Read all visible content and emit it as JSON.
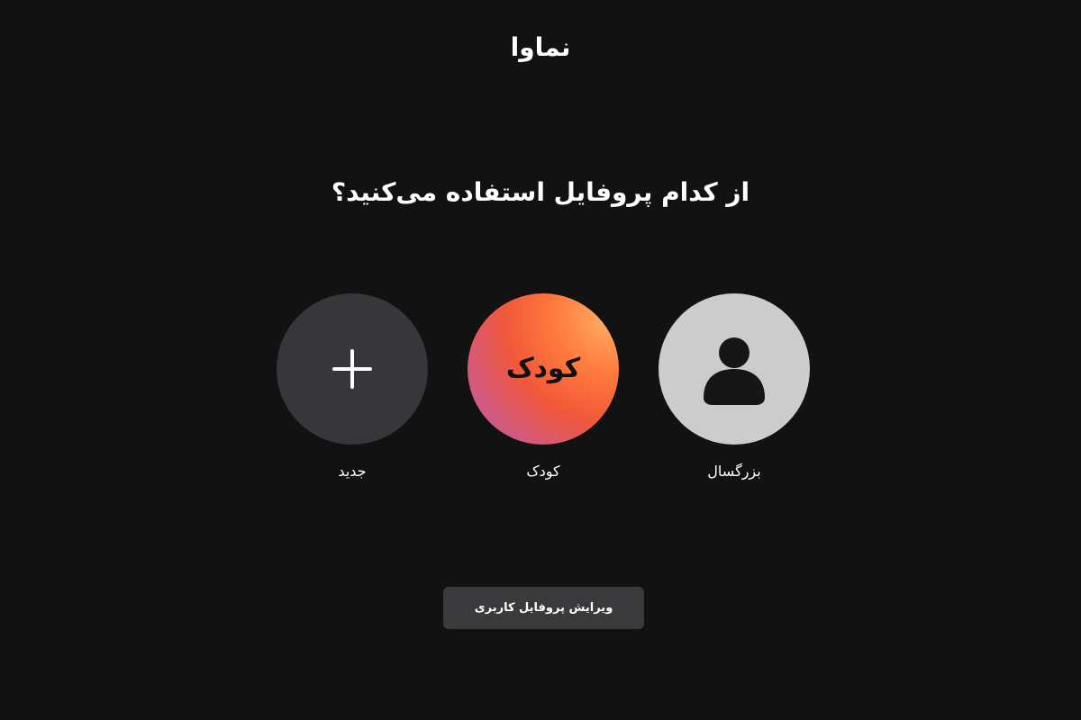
{
  "header": {
    "logo_text": "نماوا"
  },
  "main": {
    "question": "از کدام پروفایل استفاده می‌کنید؟",
    "profiles": [
      {
        "label": "جدید",
        "avatar": "plus-icon",
        "color": "#36363b"
      },
      {
        "label": "کودک",
        "avatar_text": "کودک",
        "color": "#f2583a"
      },
      {
        "label": "بزرگسال",
        "avatar": "user-icon",
        "color": "#cccccc"
      }
    ],
    "edit_button_label": "ویرایش پروفایل کاربری"
  },
  "colors": {
    "background": "#121212",
    "button_bg": "#3a3a3d",
    "adult_avatar_bg": "#cccccc",
    "adult_icon": "#161616"
  }
}
